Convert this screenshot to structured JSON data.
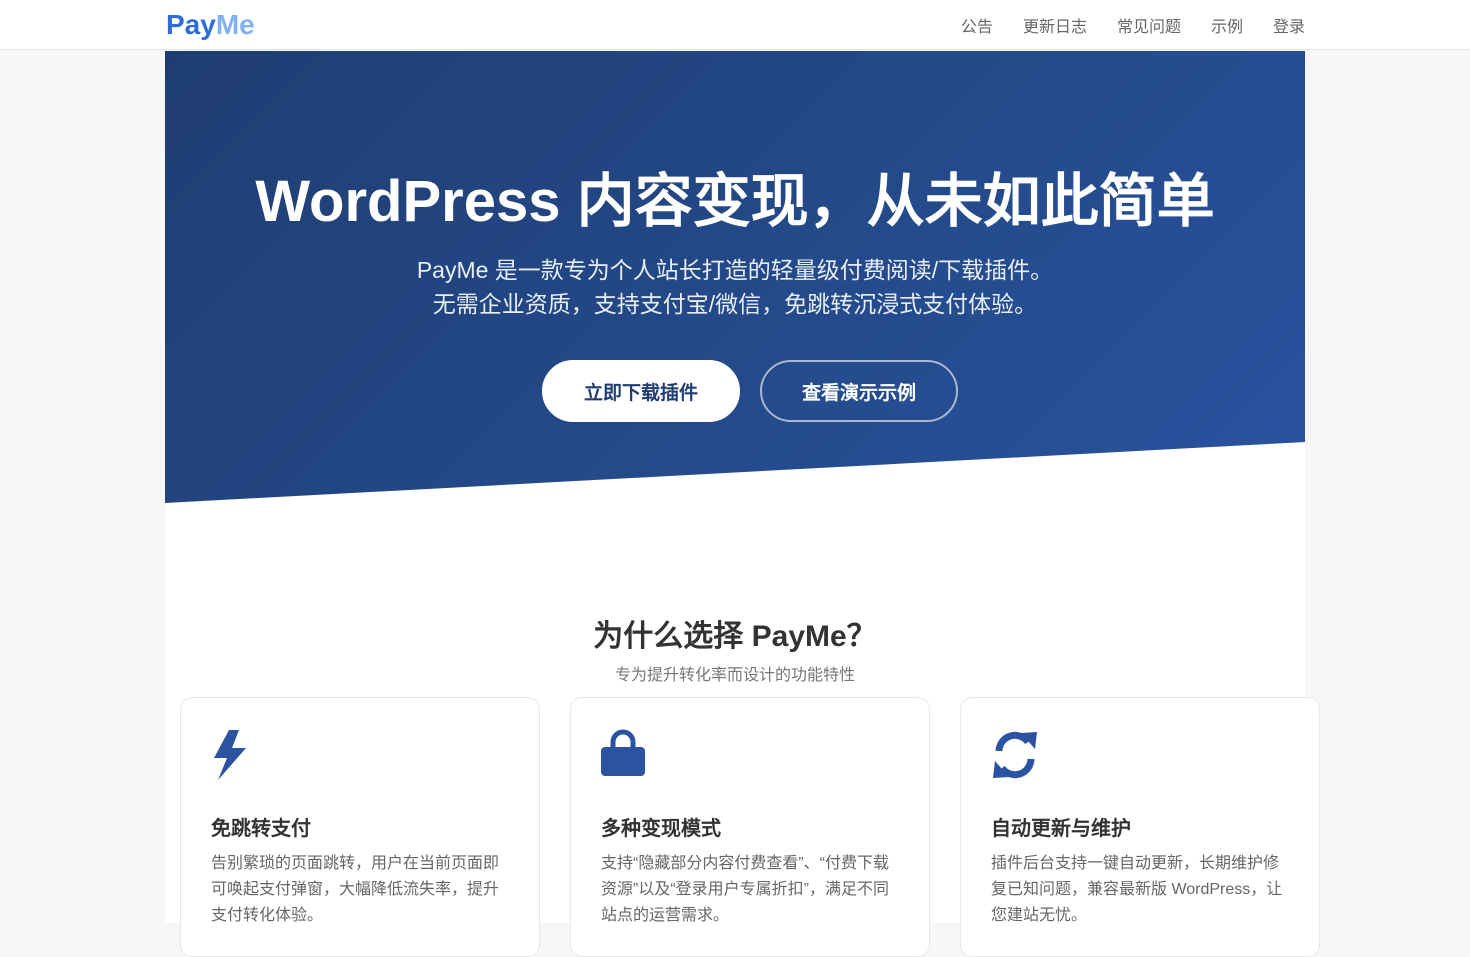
{
  "nav": {
    "logo_pay": "Pay",
    "logo_me": "Me",
    "links": [
      "公告",
      "更新日志",
      "常见问题",
      "示例",
      "登录"
    ]
  },
  "hero": {
    "title": "WordPress 内容变现，从未如此简单",
    "desc_line1": "PayMe 是一款专为个人站长打造的轻量级付费阅读/下载插件。",
    "desc_line2": "无需企业资质，支持支付宝/微信，免跳转沉浸式支付体验。",
    "btn_download": "立即下载插件",
    "btn_demo": "查看演示示例"
  },
  "features": {
    "title": "为什么选择 PayMe？",
    "subtitle": "专为提升转化率而设计的功能特性",
    "cards": [
      {
        "icon": "lightning-icon",
        "title": "免跳转支付",
        "text": "告别繁琐的页面跳转，用户在当前页面即可唤起支付弹窗，大幅降低流失率，提升支付转化体验。"
      },
      {
        "icon": "lock-icon",
        "title": "多种变现模式",
        "text": "支持“隐藏部分内容付费查看”、“付费下载资源”以及“登录用户专属折扣”，满足不同站点的运营需求。"
      },
      {
        "icon": "sync-icon",
        "title": "自动更新与维护",
        "text": "插件后台支持一键自动更新，长期维护修复已知问题，兼容最新版 WordPress，让您建站无忧。"
      }
    ]
  },
  "colors": {
    "brand": "#2d6bd6",
    "brand_light": "#7fb2f0",
    "hero_bg": "#244a8a",
    "icon": "#2a53a0"
  }
}
